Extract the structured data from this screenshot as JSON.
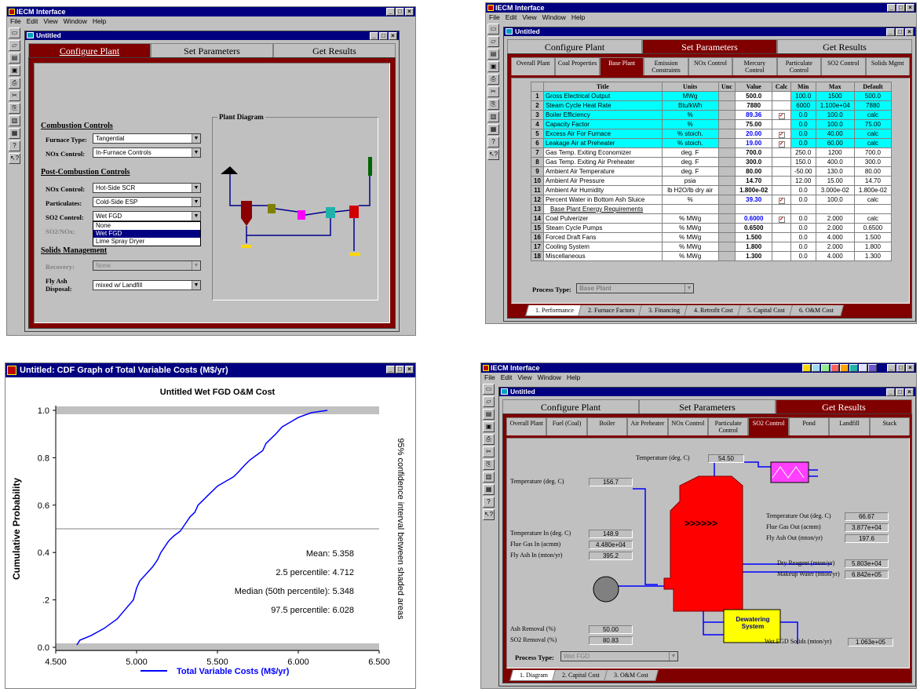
{
  "app": {
    "title": "IECM Interface",
    "menu": [
      "File",
      "Edit",
      "View",
      "Window",
      "Help"
    ],
    "child_title": "Untitled",
    "main_tabs": [
      "Configure Plant",
      "Set Parameters",
      "Get Results"
    ]
  },
  "config": {
    "combustion_heading": "Combustion Controls",
    "furnace_label": "Furnace Type:",
    "furnace_value": "Tangential",
    "nox_label": "NOx Control:",
    "nox_value": "In-Furnace Controls",
    "post_heading": "Post-Combustion Controls",
    "post_nox_label": "NOx Control:",
    "post_nox_value": "Hot-Side SCR",
    "part_label": "Particulates:",
    "part_value": "Cold-Side ESP",
    "so2_label": "SO2 Control:",
    "so2_value": "Wet FGD",
    "so2nox_label": "SO2/NOx:",
    "dropdown": [
      "None",
      "Wet FGD",
      "Lime Spray Dryer"
    ],
    "solids_heading": "Solids Management",
    "recovery_label": "Recovery:",
    "recovery_value": "None",
    "flyash_label": "Fly Ash Disposal:",
    "flyash_value": "mixed w/ Landfill",
    "diagram_title": "Plant Diagram"
  },
  "params": {
    "subtabs": [
      "Overall Plant",
      "Coal Properties",
      "Base Plant",
      "Emission Constraints",
      "NOx Control",
      "Mercury Control",
      "Particulate Control",
      "SO2 Control",
      "Solids Mgmt"
    ],
    "headers": [
      "",
      "Title",
      "Units",
      "Unc",
      "Value",
      "Calc",
      "Min",
      "Max",
      "Default"
    ],
    "rows": [
      {
        "n": "1",
        "title": "Gross Electrical Output",
        "units": "MWg",
        "value": "500.0",
        "calc": false,
        "min": "100.0",
        "max": "1500",
        "def": "500.0",
        "hl": true,
        "blue": false
      },
      {
        "n": "2",
        "title": "Steam Cycle Heat Rate",
        "units": "Btu/kWh",
        "value": "7880",
        "calc": false,
        "min": "6000",
        "max": "1.100e+04",
        "def": "7880",
        "hl": true,
        "blue": false
      },
      {
        "n": "3",
        "title": "Boiler Efficiency",
        "units": "%",
        "value": "89.36",
        "calc": true,
        "min": "0.0",
        "max": "100.0",
        "def": "calc",
        "hl": true,
        "blue": true
      },
      {
        "n": "4",
        "title": "Capacity Factor",
        "units": "%",
        "value": "75.00",
        "calc": false,
        "min": "0.0",
        "max": "100.0",
        "def": "75.00",
        "hl": true,
        "blue": false
      },
      {
        "n": "5",
        "title": "Excess Air For Furnace",
        "units": "% stoich.",
        "value": "20.00",
        "calc": true,
        "min": "0.0",
        "max": "40.00",
        "def": "calc",
        "hl": true,
        "blue": true
      },
      {
        "n": "6",
        "title": "Leakage Air at Preheater",
        "units": "% stoich.",
        "value": "19.00",
        "calc": true,
        "min": "0.0",
        "max": "60.00",
        "def": "calc",
        "hl": true,
        "blue": true
      },
      {
        "n": "7",
        "title": "Gas Temp. Exiting Economizer",
        "units": "deg. F",
        "value": "700.0",
        "calc": false,
        "min": "250.0",
        "max": "1200",
        "def": "700.0",
        "hl": false,
        "blue": false
      },
      {
        "n": "8",
        "title": "Gas Temp. Exiting Air Preheater",
        "units": "deg. F",
        "value": "300.0",
        "calc": false,
        "min": "150.0",
        "max": "400.0",
        "def": "300.0",
        "hl": false,
        "blue": false
      },
      {
        "n": "9",
        "title": "Ambient Air Temperature",
        "units": "deg. F",
        "value": "80.00",
        "calc": false,
        "min": "-50.00",
        "max": "130.0",
        "def": "80.00",
        "hl": false,
        "blue": false
      },
      {
        "n": "10",
        "title": "Ambient Air Pressure",
        "units": "psia",
        "value": "14.70",
        "calc": false,
        "min": "12.00",
        "max": "15.00",
        "def": "14.70",
        "hl": false,
        "blue": false
      },
      {
        "n": "11",
        "title": "Ambient Air Humidity",
        "units": "lb H2O/lb dry air",
        "value": "1.800e-02",
        "calc": false,
        "min": "0.0",
        "max": "3.000e-02",
        "def": "1.800e-02",
        "hl": false,
        "blue": false
      },
      {
        "n": "12",
        "title": "Percent Water in Bottom Ash Sluice",
        "units": "%",
        "value": "39.30",
        "calc": true,
        "min": "0.0",
        "max": "100.0",
        "def": "calc",
        "hl": false,
        "blue": true
      },
      {
        "n": "13",
        "title": "Base Plant Energy Requirements",
        "units": "",
        "value": "",
        "calc": false,
        "min": "",
        "max": "",
        "def": "",
        "hl": false,
        "blue": false,
        "section": true
      },
      {
        "n": "14",
        "title": "Coal Pulverizer",
        "units": "% MWg",
        "value": "0.6000",
        "calc": true,
        "min": "0.0",
        "max": "2.000",
        "def": "calc",
        "hl": false,
        "blue": true
      },
      {
        "n": "15",
        "title": "Steam Cycle Pumps",
        "units": "% MWg",
        "value": "0.6500",
        "calc": false,
        "min": "0.0",
        "max": "2.000",
        "def": "0.6500",
        "hl": false,
        "blue": false
      },
      {
        "n": "16",
        "title": "Forced Draft Fans",
        "units": "% MWg",
        "value": "1.500",
        "calc": false,
        "min": "0.0",
        "max": "4.000",
        "def": "1.500",
        "hl": false,
        "blue": false
      },
      {
        "n": "17",
        "title": "Cooling System",
        "units": "% MWg",
        "value": "1.800",
        "calc": false,
        "min": "0.0",
        "max": "2.000",
        "def": "1.800",
        "hl": false,
        "blue": false
      },
      {
        "n": "18",
        "title": "Miscellaneous",
        "units": "% MWg",
        "value": "1.300",
        "calc": false,
        "min": "0.0",
        "max": "4.000",
        "def": "1.300",
        "hl": false,
        "blue": false
      }
    ],
    "process_label": "Process Type:",
    "process_value": "Base Plant",
    "bottom_tabs": [
      "1. Performance",
      "2. Furnace Factors",
      "3. Financing",
      "4. Retrofit Cost",
      "5. Capital Cost",
      "6. O&M Cost"
    ]
  },
  "cdf": {
    "window_title": "Untitled: CDF Graph of Total Variable Costs (M$/yr)",
    "stats": [
      "Mean: 5.358",
      "2.5 percentile: 4.712",
      "Median (50th percentile): 5.348",
      "97.5 percentile: 6.028"
    ],
    "side_label": "95% confidence interval between shaded areas"
  },
  "chart_data": {
    "type": "line",
    "title": "Untitled Wet FGD O&M Cost",
    "xlabel": "",
    "ylabel": "Cumulative Probability",
    "xlim": [
      4.5,
      6.5
    ],
    "ylim": [
      0,
      1
    ],
    "x_ticks": [
      "4.500",
      "5.000",
      "5.500",
      "6.000",
      "6.500"
    ],
    "y_ticks": [
      "0.0",
      ".2",
      "0.4",
      "0.6",
      "0.8",
      "1.0"
    ],
    "legend": "Total Variable Costs (M$/yr)",
    "series": [
      {
        "name": "Total Variable Costs (M$/yr)",
        "x": [
          4.63,
          4.65,
          4.72,
          4.8,
          4.88,
          4.93,
          4.98,
          5.0,
          5.02,
          5.06,
          5.1,
          5.13,
          5.15,
          5.18,
          5.2,
          5.23,
          5.27,
          5.3,
          5.33,
          5.36,
          5.38,
          5.41,
          5.44,
          5.47,
          5.5,
          5.55,
          5.6,
          5.63,
          5.67,
          5.7,
          5.74,
          5.78,
          5.8,
          5.83,
          5.86,
          5.9,
          5.95,
          6.0,
          6.08,
          6.18
        ],
        "y": [
          0.01,
          0.03,
          0.05,
          0.08,
          0.12,
          0.16,
          0.2,
          0.25,
          0.28,
          0.31,
          0.34,
          0.37,
          0.4,
          0.43,
          0.45,
          0.47,
          0.49,
          0.52,
          0.55,
          0.57,
          0.6,
          0.62,
          0.64,
          0.66,
          0.68,
          0.7,
          0.72,
          0.74,
          0.77,
          0.79,
          0.81,
          0.83,
          0.86,
          0.88,
          0.9,
          0.93,
          0.95,
          0.97,
          0.99,
          1.0
        ]
      }
    ],
    "shaded_bands": [
      0.025,
      0.975
    ],
    "median_line": 0.5
  },
  "results": {
    "subtabs": [
      "Overall Plant",
      "Fuel (Coal)",
      "Boiler",
      "Air Preheater",
      "NOx Control",
      "Particulate Control",
      "SO2 Control",
      "Pond",
      "Landfill",
      "Stack"
    ],
    "temp_top_label": "Temperature (deg. C)",
    "temp_top": "54.50",
    "temp_left_label": "Temperature (deg. C)",
    "temp_left": "156.7",
    "temp_in_label": "Temperature In (deg. C)",
    "temp_in": "148.9",
    "flue_in_label": "Flue Gas In (acmm)",
    "flue_in": "4.480e+04",
    "fly_in_label": "Fly Ash In (mton/yr)",
    "fly_in": "395.2",
    "temp_out_label": "Temperature Out (deg. C)",
    "temp_out": "66.67",
    "flue_out_label": "Flue Gas Out (acmm)",
    "flue_out": "3.877e+04",
    "fly_out_label": "Fly Ash Out (mton/yr)",
    "fly_out": "197.6",
    "dry_label": "Dry Reagent (mton/yr)",
    "dry": "5.803e+04",
    "makeup_label": "Makeup Water (mton/yr)",
    "makeup": "6.842e+05",
    "ash_label": "Ash Removal (%)",
    "ash": "50.00",
    "so2r_label": "SO2 Removal (%)",
    "so2r": "80.83",
    "solids_label": "Wet FGD Solids (mton/yr)",
    "solids": "1.063e+05",
    "dewater": "Dewatering System",
    "process_label": "Process Type:",
    "process_value": "Wet FGD",
    "bottom_tabs": [
      "1. Diagram",
      "2. Capital Cost",
      "3. O&M Cost"
    ]
  }
}
